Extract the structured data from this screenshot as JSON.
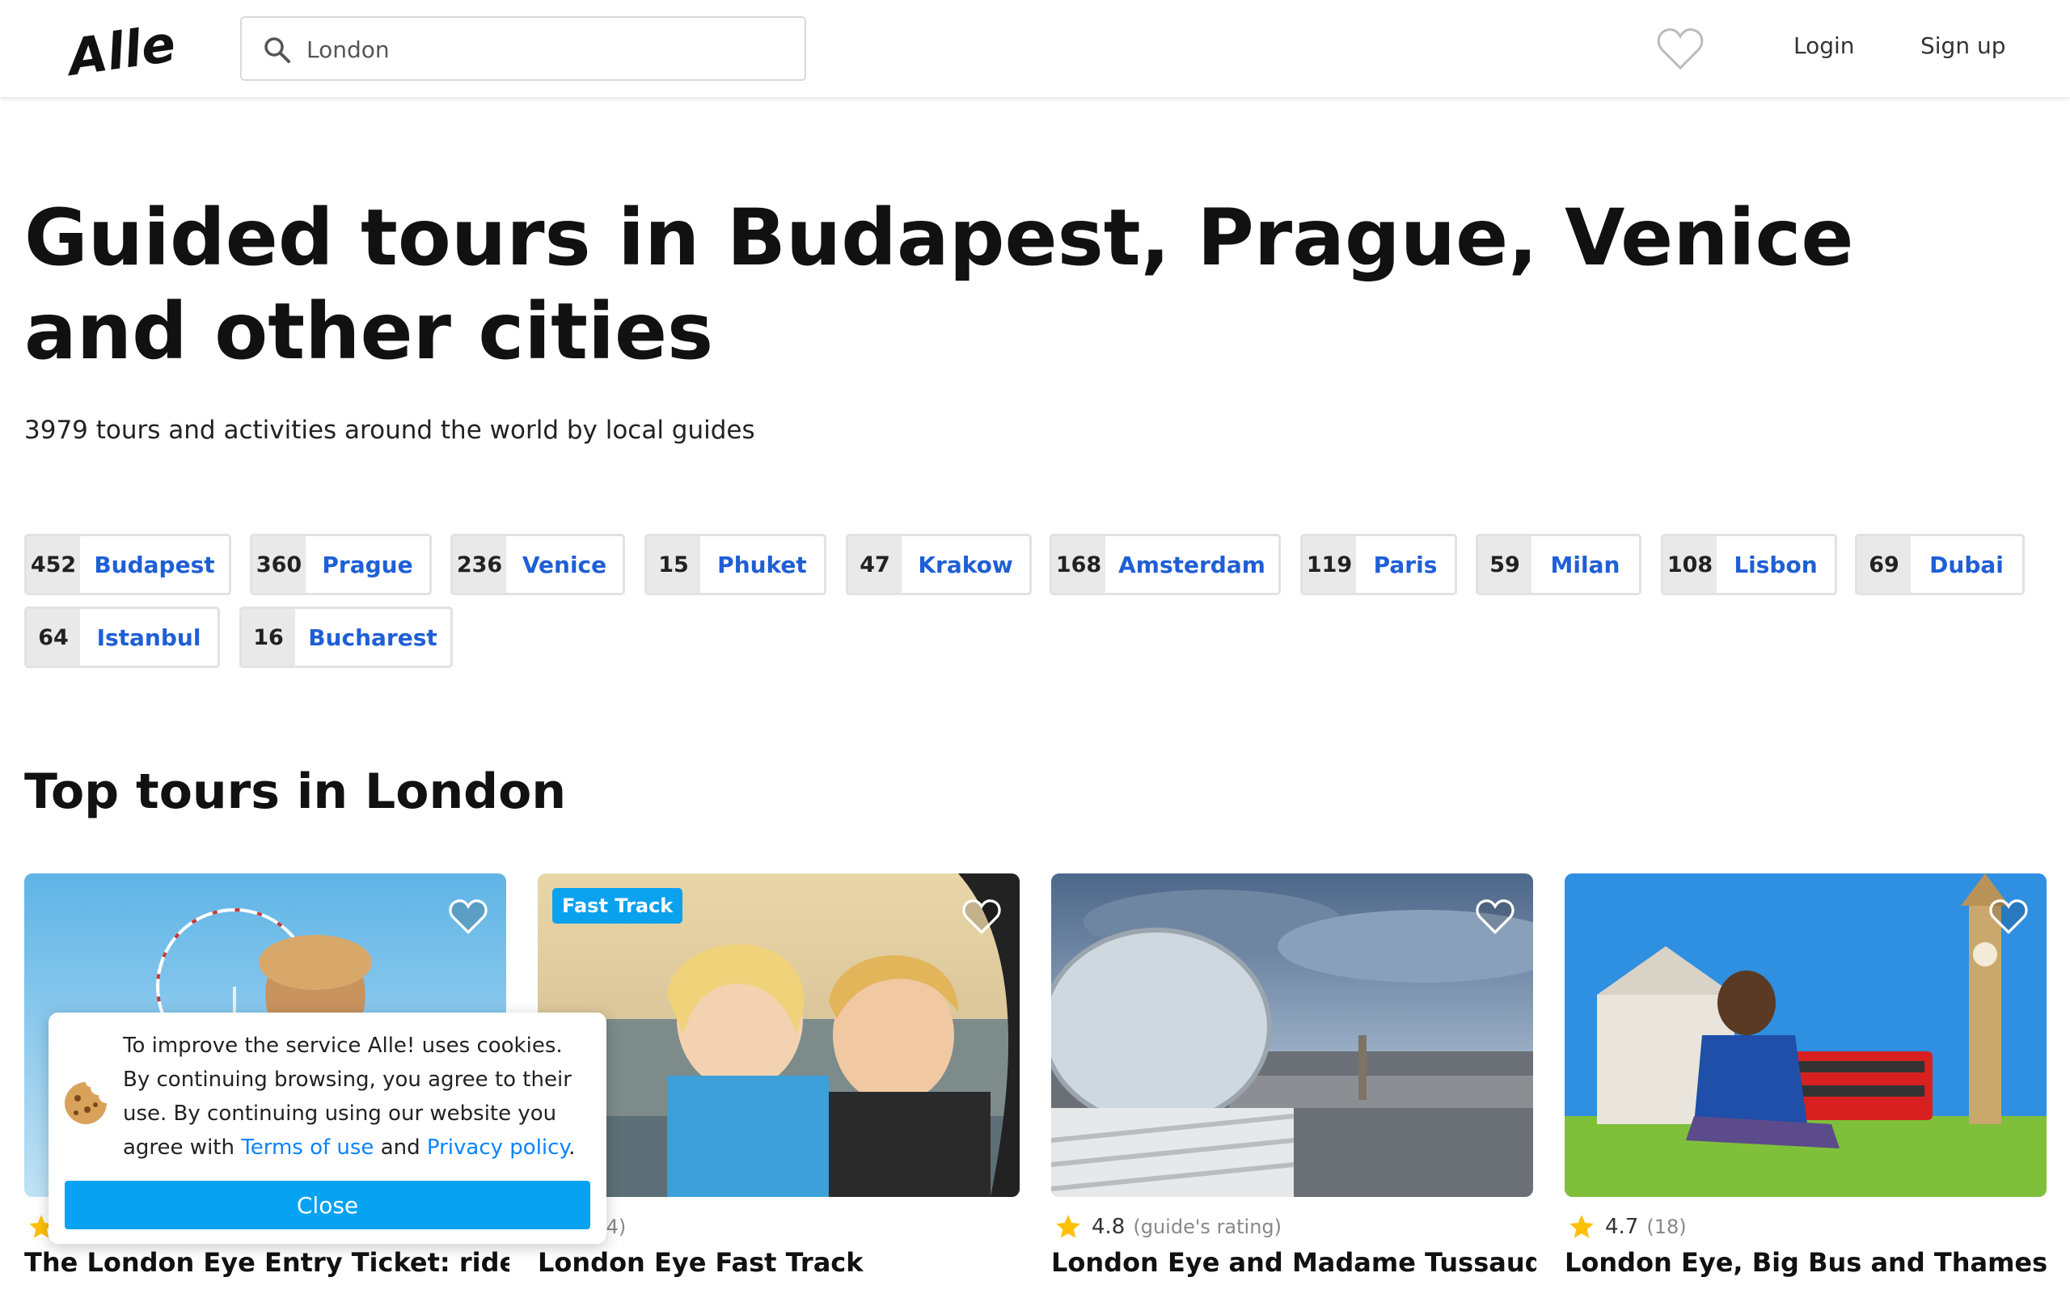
{
  "header": {
    "logo_text": "Alle!",
    "search": {
      "value": "London",
      "placeholder": "London"
    },
    "login_label": "Login",
    "signup_label": "Sign up"
  },
  "hero": {
    "title": "Guided tours in Budapest, Prague, Venice and other cities",
    "subtitle": "3979 tours and activities around the world by local guides"
  },
  "cities": [
    {
      "count": "452",
      "name": "Budapest"
    },
    {
      "count": "360",
      "name": "Prague"
    },
    {
      "count": "236",
      "name": "Venice"
    },
    {
      "count": "15",
      "name": "Phuket"
    },
    {
      "count": "47",
      "name": "Krakow"
    },
    {
      "count": "168",
      "name": "Amsterdam"
    },
    {
      "count": "119",
      "name": "Paris"
    },
    {
      "count": "59",
      "name": "Milan"
    },
    {
      "count": "108",
      "name": "Lisbon"
    },
    {
      "count": "69",
      "name": "Dubai"
    },
    {
      "count": "64",
      "name": "Istanbul"
    },
    {
      "count": "16",
      "name": "Bucharest"
    }
  ],
  "section_title": "Top tours in London",
  "cards": [
    {
      "title": "The London Eye Entry Ticket: ride the",
      "rating": "",
      "reviews": "",
      "badge": ""
    },
    {
      "title": "London Eye Fast Track",
      "rating": "",
      "reviews": "(14)",
      "badge": "Fast Track"
    },
    {
      "title": "London Eye and Madame Tussauds",
      "rating": "4.8",
      "reviews": "(guide's rating)",
      "badge": ""
    },
    {
      "title": "London Eye, Big Bus and Thames",
      "rating": "4.7",
      "reviews": "(18)",
      "badge": ""
    }
  ],
  "cookie": {
    "text_before": "To improve the service Alle! uses cookies. By continuing browsing, you agree to their use. By continuing using our website you agree with ",
    "terms_link": "Terms of use",
    "and_text": " and ",
    "privacy_link": "Privacy policy",
    "text_after": ".",
    "close_label": "Close"
  },
  "colors": {
    "link_blue": "#1f5fd6",
    "close_button": "#07a3f2",
    "badge": "#0aa1ef",
    "star": "#ffc107"
  },
  "icons": [
    "search-icon",
    "heart-icon",
    "star-icon",
    "cookie-icon"
  ]
}
